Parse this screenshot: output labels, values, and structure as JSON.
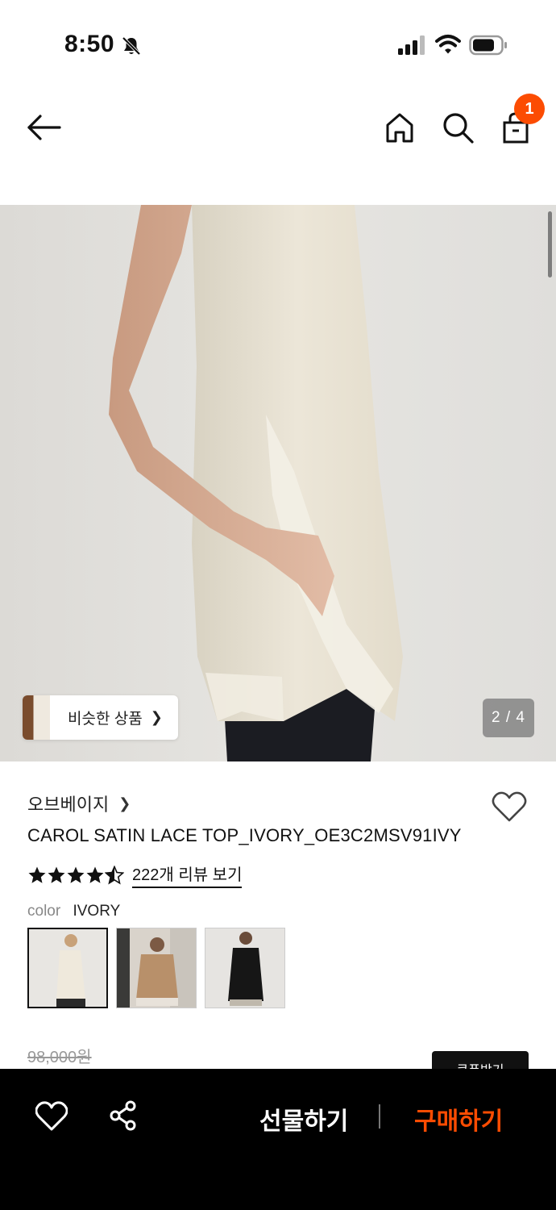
{
  "status_bar": {
    "time": "8:50",
    "icons": [
      "bell-slash-icon",
      "cellular-signal-icon",
      "wifi-icon",
      "battery-icon"
    ]
  },
  "header": {
    "icons": [
      "back-arrow-icon",
      "home-icon",
      "search-icon",
      "shopping-bag-icon"
    ],
    "cart_badge": "1"
  },
  "gallery": {
    "similar_products_label": "비슷한 상품",
    "page_counter": "2 / 4"
  },
  "product": {
    "brand": "오브베이지",
    "title": "CAROL SATIN LACE TOP_IVORY_OE3C2MSV91IVY",
    "rating": 4.5,
    "review_link": "222개 리뷰 보기",
    "color_label": "color",
    "color_value": "IVORY",
    "swatch_count": 3,
    "original_price": "98,000원",
    "coupon_label": "쿠폰받기"
  },
  "bottom_bar": {
    "gift_label": "선물하기",
    "buy_label": "구매하기",
    "icons": [
      "heart-outline-icon",
      "share-icon"
    ]
  },
  "colors": {
    "accent": "#fc4c02",
    "bottom_bar_bg": "#000000",
    "text_primary": "#111111",
    "text_muted": "#888888"
  }
}
